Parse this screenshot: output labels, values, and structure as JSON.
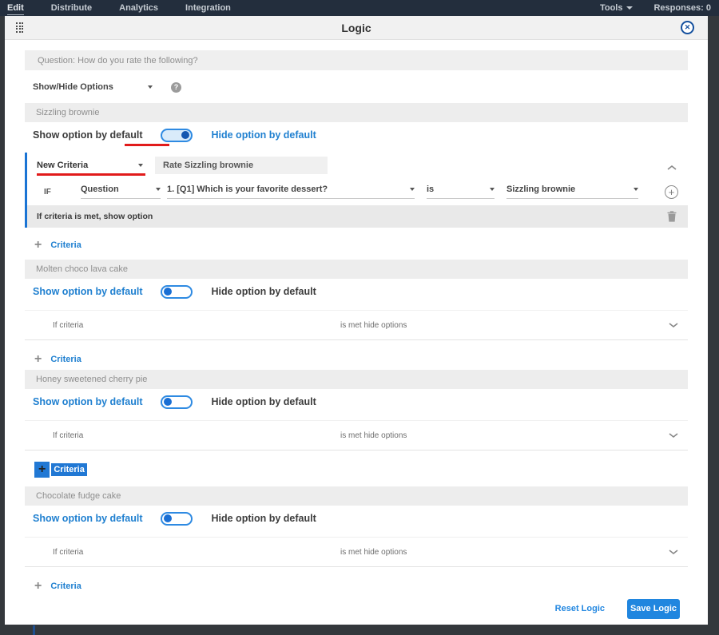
{
  "colors": {
    "topbar_bg": "#232e3d",
    "accent_blue": "#2080d0",
    "save_button_bg": "#2086df",
    "annotation_red": "#e11b1b"
  },
  "topbar": {
    "tabs": [
      {
        "label": "Edit"
      },
      {
        "label": "Distribute"
      },
      {
        "label": "Analytics"
      },
      {
        "label": "Integration"
      }
    ],
    "tools": "Tools",
    "responses": "Responses: 0"
  },
  "dialog": {
    "title": "Logic",
    "question": "Question: How do you rate the following?",
    "logic_type": "Show/Hide Options",
    "sections": [
      {
        "name": "Sizzling brownie",
        "show_label": "Show option by default",
        "hide_label": "Hide option by default",
        "criteria": {
          "type": "New Criteria",
          "name": "Rate Sizzling brownie",
          "if": "IF",
          "subject": "Question",
          "question": "1. [Q1] Which is your favorite dessert?",
          "operator": "is",
          "value": "Sizzling brownie",
          "result": "If criteria is met, show option"
        },
        "add_label": "Criteria"
      },
      {
        "name": "Molten choco lava cake",
        "show_label": "Show option by default",
        "hide_label": "Hide option by default",
        "collapsed_left": "If criteria",
        "collapsed_right": "is met hide options",
        "add_label": "Criteria"
      },
      {
        "name": "Honey sweetened cherry pie",
        "show_label": "Show option by default",
        "hide_label": "Hide option by default",
        "collapsed_left": "If criteria",
        "collapsed_right": "is met hide options",
        "add_label": "Criteria"
      },
      {
        "name": "Chocolate fudge cake",
        "show_label": "Show option by default",
        "hide_label": "Hide option by default",
        "collapsed_left": "If criteria",
        "collapsed_right": "is met hide options",
        "add_label": "Criteria"
      }
    ],
    "footer": {
      "reset": "Reset Logic",
      "save": "Save Logic"
    }
  }
}
